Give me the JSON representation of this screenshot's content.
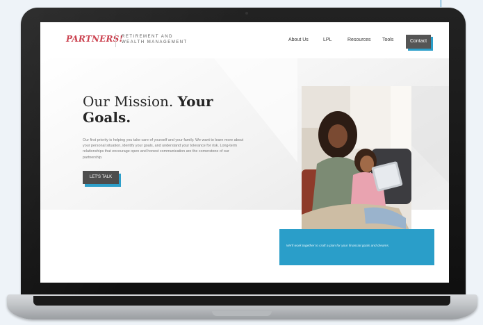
{
  "site": {
    "logo": "PARTNERS!",
    "tagline_line1": "RETIREMENT AND",
    "tagline_line2": "WEALTH MANAGEMENT"
  },
  "nav": {
    "items": [
      "About Us",
      "LPL",
      "Resources",
      "Tools"
    ],
    "contact": "Contact"
  },
  "hero": {
    "headline_part1": "Our Mission.",
    "headline_part2": "Your",
    "headline_part3": "Goals.",
    "body": "Our first priority is helping you take care of yourself and your family. We want to learn more about your personal situation, identify your goals, and understand your tolerance for risk. Long-term relationships that encourage open and honest communication are the cornerstone of our partnership.",
    "cta": "LET'S TALK",
    "caption": "We'll work together to craft a plan for your financial goals and dreams."
  },
  "colors": {
    "accent": "#2a9ec9",
    "logo": "#c93a48",
    "button": "#4a4a4a"
  }
}
